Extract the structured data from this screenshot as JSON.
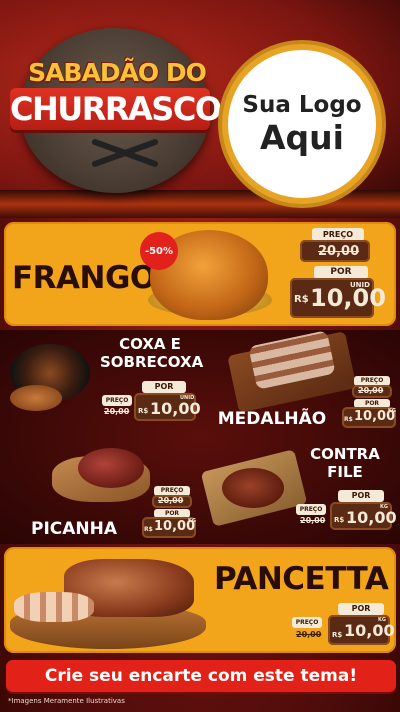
{
  "header": {
    "title_line1": "SABADÃO DO",
    "title_line2": "CHURRASCO",
    "logo_line1": "Sua Logo",
    "logo_line2": "Aqui"
  },
  "labels": {
    "preco": "PREÇO",
    "por": "POR",
    "currency": "R$",
    "old_price": "20,00",
    "new_price": "10,00",
    "unid_short": "UNID",
    "unid": "UNID",
    "kg": "KG"
  },
  "products": {
    "frango": {
      "name": "FRANGO",
      "discount": "-50%"
    },
    "coxa": {
      "name_l1": "COXA E",
      "name_l2": "SOBRECOXA"
    },
    "medalhao": {
      "name": "MEDALHÃO"
    },
    "picanha": {
      "name": "PICANHA"
    },
    "contra_file": {
      "name_l1": "CONTRA",
      "name_l2": "FILE"
    },
    "pancetta": {
      "name": "PANCETTA"
    }
  },
  "footer": {
    "cta": "Crie seu encarte com este tema!",
    "disclaimer": "*Imagens Meramente Ilustrativas"
  },
  "colors": {
    "brand_red": "#e22219",
    "card_yellow": "#f2a51a",
    "tag_brown": "#5a2a14",
    "tag_cream": "#f4ead7"
  }
}
